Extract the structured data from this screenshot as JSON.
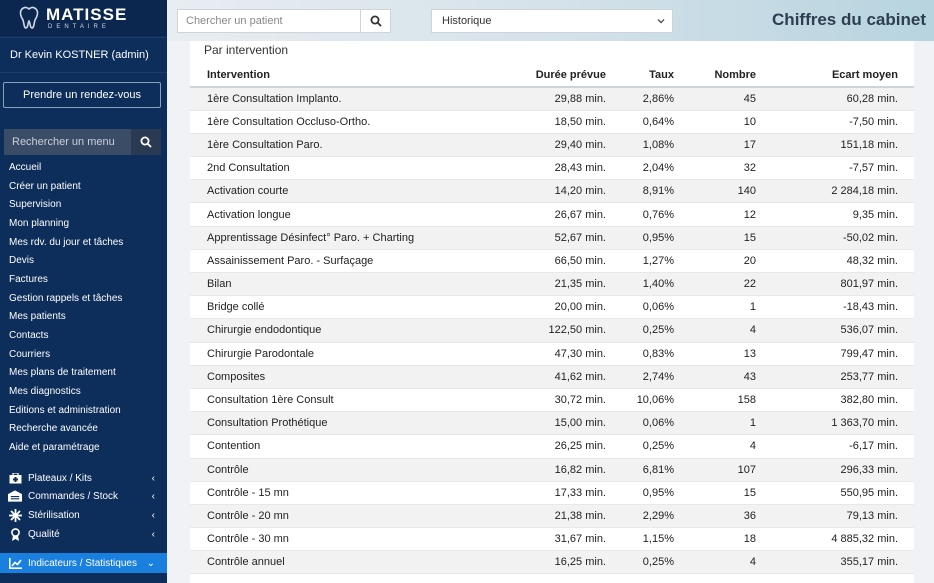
{
  "app": {
    "logo_name": "MATISSE",
    "logo_sub": "DENTAIRE",
    "user": "Dr Kevin KOSTNER (admin)",
    "appointment_button": "Prendre un rendez-vous",
    "menu_search_placeholder": "Rechercher un menu"
  },
  "sidebar": {
    "items": [
      "Accueil",
      "Créer un patient",
      "Supervision",
      "Mon planning",
      "Mes rdv. du jour et tâches",
      "Devis",
      "Factures",
      "Gestion rappels et tâches",
      "Mes patients",
      "Contacts",
      "Courriers",
      "Mes plans de traitement",
      "Mes diagnostics",
      "Editions et administration",
      "Recherche avancée",
      "Aide et paramétrage"
    ],
    "groups": [
      {
        "label": "Plateaux / Kits",
        "icon": "tray-icon"
      },
      {
        "label": "Commandes / Stock",
        "icon": "warehouse-icon"
      },
      {
        "label": "Stérilisation",
        "icon": "sterilization-icon"
      },
      {
        "label": "Qualité",
        "icon": "award-icon"
      },
      {
        "label": "Indicateurs / Statistiques",
        "icon": "chart-icon",
        "active": true
      }
    ]
  },
  "topbar": {
    "patient_search_placeholder": "Chercher un patient",
    "history_select_value": "Historique",
    "page_title": "Chiffres du cabinet"
  },
  "main": {
    "section_title": "Par intervention",
    "columns": [
      "Intervention",
      "Durée prévue",
      "Taux",
      "Nombre",
      "Ecart moyen"
    ],
    "rows": [
      [
        "1ère Consultation Implanto.",
        "29,88 min.",
        "2,86%",
        "45",
        "60,28 min."
      ],
      [
        "1ère Consultation Occluso-Ortho.",
        "18,50 min.",
        "0,64%",
        "10",
        "-7,50 min."
      ],
      [
        "1ère Consultation Paro.",
        "29,40 min.",
        "1,08%",
        "17",
        "151,18 min."
      ],
      [
        "2nd Consultation",
        "28,43 min.",
        "2,04%",
        "32",
        "-7,57 min."
      ],
      [
        "Activation courte",
        "14,20 min.",
        "8,91%",
        "140",
        "2 284,18 min."
      ],
      [
        "Activation longue",
        "26,67 min.",
        "0,76%",
        "12",
        "9,35 min."
      ],
      [
        "Apprentissage Désinfect° Paro. + Charting",
        "52,67 min.",
        "0,95%",
        "15",
        "-50,02 min."
      ],
      [
        "Assainissement Paro. - Surfaçage",
        "66,50 min.",
        "1,27%",
        "20",
        "48,32 min."
      ],
      [
        "Bilan",
        "21,35 min.",
        "1,40%",
        "22",
        "801,97 min."
      ],
      [
        "Bridge collé",
        "20,00 min.",
        "0,06%",
        "1",
        "-18,43 min."
      ],
      [
        "Chirurgie endodontique",
        "122,50 min.",
        "0,25%",
        "4",
        "536,07 min."
      ],
      [
        "Chirurgie Parodontale",
        "47,30 min.",
        "0,83%",
        "13",
        "799,47 min."
      ],
      [
        "Composites",
        "41,62 min.",
        "2,74%",
        "43",
        "253,77 min."
      ],
      [
        "Consultation 1ère Consult",
        "30,72 min.",
        "10,06%",
        "158",
        "382,80 min."
      ],
      [
        "Consultation Prothétique",
        "15,00 min.",
        "0,06%",
        "1",
        "1 363,70 min."
      ],
      [
        "Contention",
        "26,25 min.",
        "0,25%",
        "4",
        "-6,17 min."
      ],
      [
        "Contrôle",
        "16,82 min.",
        "6,81%",
        "107",
        "296,33 min."
      ],
      [
        "Contrôle - 15 mn",
        "17,33 min.",
        "0,95%",
        "15",
        "550,95 min."
      ],
      [
        "Contrôle - 20 mn",
        "21,38 min.",
        "2,29%",
        "36",
        "79,13 min."
      ],
      [
        "Contrôle - 30 mn",
        "31,67 min.",
        "1,15%",
        "18",
        "4 885,32 min."
      ],
      [
        "Contrôle annuel",
        "16,25 min.",
        "0,25%",
        "4",
        "355,17 min."
      ]
    ]
  }
}
